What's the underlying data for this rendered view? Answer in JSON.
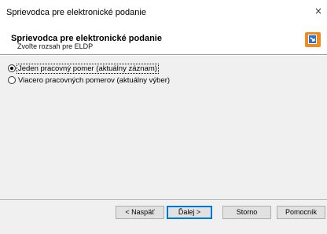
{
  "window": {
    "title": "Sprievodca pre elektronické podanie",
    "close_glyph": "×"
  },
  "header": {
    "title": "Sprievodca pre elektronické podanie",
    "subtitle": "Zvoľte rozsah pre ELDP",
    "logo_icon": "wizard-export-icon"
  },
  "options": {
    "items": [
      {
        "label": "Jeden pracovný pomer (aktuálny záznam)",
        "selected": true
      },
      {
        "label": "Viacero pracovných pomerov (aktuálny výber)",
        "selected": false
      }
    ]
  },
  "buttons": {
    "back_label": "< Naspäť",
    "next_label": "Ďalej >",
    "cancel_label": "Storno",
    "help_label": "Pomocník"
  },
  "colors": {
    "content_bg": "#f0f0f0",
    "logo_orange": "#f08c1e",
    "logo_blue": "#2a6fd6"
  }
}
